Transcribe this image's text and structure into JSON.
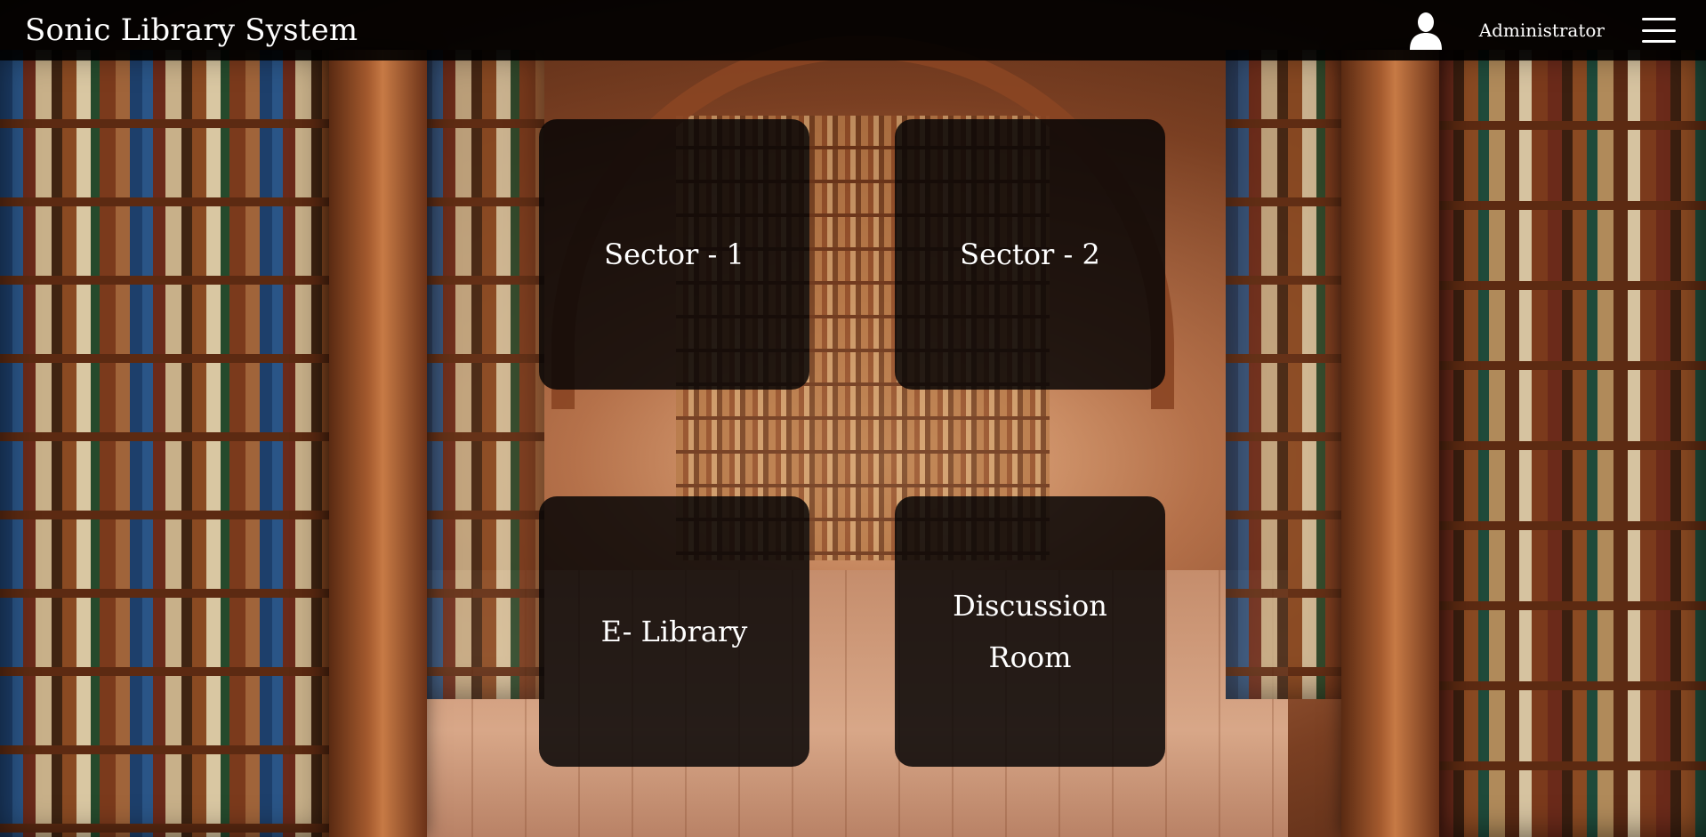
{
  "header": {
    "title": "Sonic Library System",
    "user_name": "Administrator",
    "user_icon": "user-icon",
    "menu_icon": "hamburger-menu-icon"
  },
  "tiles": [
    {
      "label": "Sector - 1"
    },
    {
      "label": "Sector - 2"
    },
    {
      "label": "E- Library"
    },
    {
      "label": "Discussion Room"
    }
  ],
  "colors": {
    "header_bg": "#000000",
    "tile_bg": "#0b0808",
    "text": "#ffffff"
  }
}
